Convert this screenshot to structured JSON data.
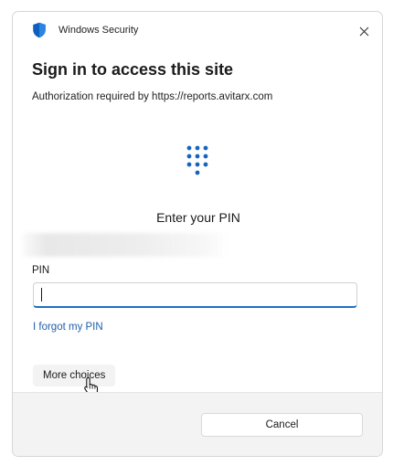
{
  "window": {
    "title": "Windows Security",
    "shield_icon": "windows-security-shield-icon",
    "close_icon": "close-icon",
    "accent_color": "#0f5fc0"
  },
  "main": {
    "heading": "Sign in to access this site",
    "authorization_text": "Authorization required by https://reports.avitarx.com",
    "keypad_icon": "pin-keypad-icon",
    "prompt": "Enter your PIN",
    "pin_label": "PIN",
    "pin_value": "",
    "forgot_link": "I forgot my PIN",
    "more_choices": "More choices"
  },
  "footer": {
    "cancel_label": "Cancel"
  },
  "colors": {
    "link": "#1f5fae",
    "input_focus_underline": "#1f6fc5",
    "footer_background": "#f3f3f3"
  }
}
